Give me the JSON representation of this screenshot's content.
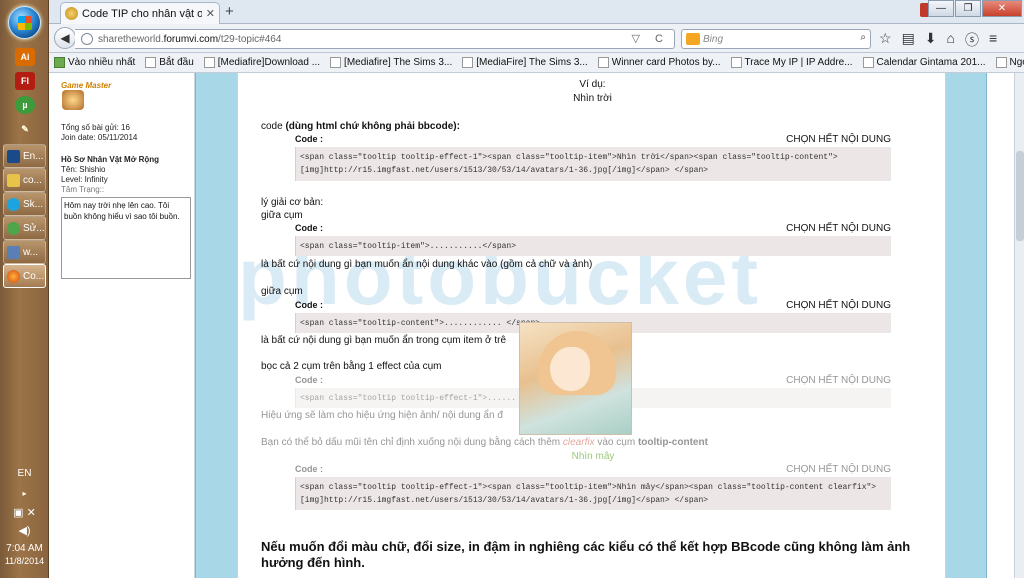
{
  "taskbar": {
    "buttons": [
      "En...",
      "co...",
      "Sk...",
      "Sử...",
      "w...",
      "Co..."
    ],
    "lang": "EN",
    "time": "7:04 AM",
    "date": "11/8/2014"
  },
  "browser": {
    "tab_title": "Code TIP cho nhân vật or ...",
    "url_prefix": "sharetheworld.",
    "url_host": "forumvi.com",
    "url_path": "/t29-topic#464",
    "search_placeholder": "Bing",
    "bookmarks": [
      "Vào nhiều nhất",
      "Bắt đầu",
      "[Mediafire]Download ...",
      "[Mediafire] The Sims 3...",
      "[MediaFire] The Sims 3...",
      "Winner card Photos by...",
      "Trace My IP | IP Addre...",
      "Calendar Gintama 201...",
      "NgoiLaiBenNhau-Giup..."
    ]
  },
  "profile": {
    "rank": "Game Master",
    "posts_label": "Tổng số bài gửi: 16",
    "join_label": "Join date: 05/11/2014",
    "section_title": "Hồ Sơ Nhân Vật Mở Rộng",
    "name_label": "Tên: Shishio",
    "level_label": "Level: Infinity",
    "mood_label": "Tâm Trạng::",
    "mood_text": "Hôm nay trời nhẹ lên cao. Tôi buồn không hiểu vì sao tôi buồn."
  },
  "post": {
    "example_label": "Ví dụ:",
    "example_text": "Nhìn trời",
    "code_intro_a": "code ",
    "code_intro_b": "(dùng html chứ không phải bbcode):",
    "code_label": "Code :",
    "select_all": "CHỌN HẾT NỘI DUNG",
    "code1": "<span class=\"tooltip tooltip-effect-1\"><span class=\"tooltip-item\">Nhìn trời</span><span class=\"tooltip-content\">[img]http://r15.imgfast.net/users/1513/30/53/14/avatars/1-36.jpg[/img]</span> </span>",
    "explain_title": "lý giải cơ bản:",
    "between_label": "giữa cụm",
    "code2": "<span class=\"tooltip-item\">...........</span>",
    "text2": "là bất cứ nội dung gì bạn muốn ẩn nội dung khác vào (gồm cả chữ và ảnh)",
    "between_label2": "giữa cụm",
    "code3": "<span class=\"tooltip-content\">............ </span>",
    "text3": "là bất cứ nội dung gì bạn muốn ẩn trong cụm item ở trê",
    "text4": "bọc cả 2 cụm trên bằng 1 effect của cụm",
    "code4": "<span class=\"tooltip tooltip-effect-1\">......",
    "text5": "Hiệu ứng sẽ làm cho hiệu ứng hiện ảnh/ nội dung ẩn đ",
    "text6a": "Bạn có thể bỏ dấu mũi tên chỉ định xuống nội dung bằng cách thêm ",
    "text6b": "clearfix",
    "text6c": " vào cụm ",
    "text6d": "tooltip-content",
    "popup_caption": "Nhìn mây",
    "code5": "<span class=\"tooltip tooltip-effect-1\"><span class=\"tooltip-item\">Nhìn mây</span><span class=\"tooltip-content clearfix\">[img]http://r15.imgfast.net/users/1513/30/53/14/avatars/1-36.jpg[/img]</span> </span>",
    "big_text": "Nếu muốn đổi màu chữ, đổi size, in đậm in nghiêng các kiểu có thể kết hợp BBcode cũng không làm ảnh hưởng đến hình."
  },
  "watermark": "photobucket",
  "colors": {
    "rank": "#d08000",
    "decor": "#a8d7e8",
    "code_bg": "#ece6e6",
    "clearfix": "#c0392b"
  }
}
